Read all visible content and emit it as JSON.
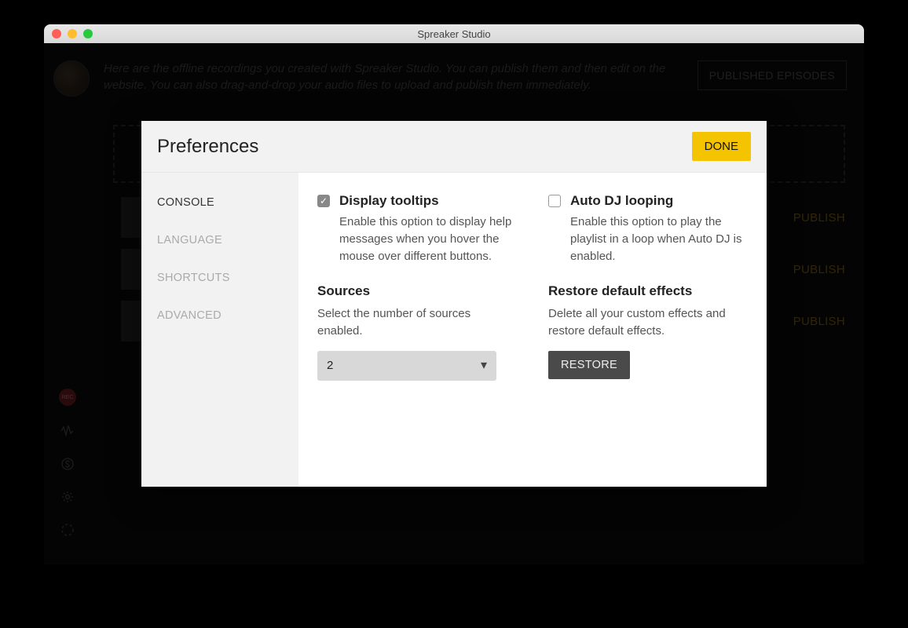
{
  "window": {
    "title": "Spreaker Studio"
  },
  "header": {
    "intro": "Here are the offline recordings you created with Spreaker Studio. You can publish them and then edit on the website. You can also drag-and-drop your audio files to upload and publish them immediately.",
    "published_button": "PUBLISHED EPISODES"
  },
  "episodes": {
    "publish_label": "PUBLISH"
  },
  "rail": {
    "rec_label": "REC"
  },
  "modal": {
    "title": "Preferences",
    "done": "DONE",
    "sidebar": {
      "items": [
        "CONSOLE",
        "LANGUAGE",
        "SHORTCUTS",
        "ADVANCED"
      ],
      "active_index": 0
    },
    "console": {
      "tooltips": {
        "title": "Display tooltips",
        "desc": "Enable this option to display help messages when you hover the mouse over different buttons.",
        "checked": true
      },
      "autodj": {
        "title": "Auto DJ looping",
        "desc": "Enable this option to play the playlist in a loop when Auto DJ is enabled.",
        "checked": false
      },
      "sources": {
        "title": "Sources",
        "desc": "Select the number of sources enabled.",
        "value": "2"
      },
      "restore": {
        "title": "Restore default effects",
        "desc": "Delete all your custom effects and restore default effects.",
        "button": "RESTORE"
      }
    }
  }
}
